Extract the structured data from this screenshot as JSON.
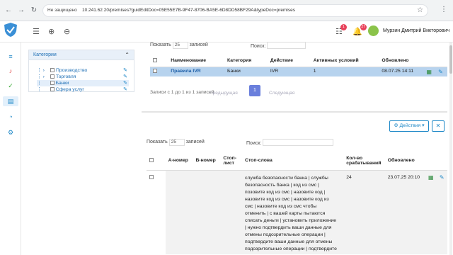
{
  "browser": {
    "warning": "Не защищено",
    "url": "10.241.62.20/premises?guidEditDoc=05E55E7B-9F47-8706-BA5E-6D8DD58BF29A&typeDoc=premises"
  },
  "header": {
    "user_name": "Мурзин Дмитрий Викторович",
    "badge_tasks": "1",
    "badge_notifications": "27"
  },
  "categories": {
    "title": "Категории",
    "items": [
      {
        "label": "Производство"
      },
      {
        "label": "Торговля"
      },
      {
        "label": "Банки"
      },
      {
        "label": "Сфера услуг"
      }
    ]
  },
  "table1": {
    "show_label": "Показать",
    "page_size": "25",
    "records_label": "записей",
    "search_label": "Поиск:",
    "headers": [
      "Наименование",
      "Категория",
      "Действие",
      "Активных условий",
      "Обновлено"
    ],
    "row": {
      "name": "Правила IVR",
      "category": "Банки",
      "action": "IVR",
      "active": "1",
      "updated": "08.07.25 14:11"
    },
    "info": "Записи с 1 до 1 из 1 записей",
    "prev": "Предыдущая",
    "page": "1",
    "next": "Следующая"
  },
  "table2": {
    "show_label": "Показать",
    "page_size": "25",
    "records_label": "записей",
    "search_label": "Поиск:",
    "actions_label": "Действия",
    "headers": [
      "А-номер",
      "В-номер",
      "Стоп-лист",
      "Стоп-слова",
      "Кол-во срабатываний",
      "Обновлено"
    ],
    "row": {
      "a": "",
      "b": "",
      "stop": "",
      "words": "служба безопасности банка | службы безопасность банка | код из смс | позовите код из смс | назовите код | назовите код из смс | назовите код из смс | назовите код из смс чтобы отменить | с вашей карты пытаются списать деньги | установить приложение | нужно подтвердить ваши данные для отмены подозрительные операции | подтвердите ваши данные для отмены подозрительные операции | подтвердите",
      "count": "24",
      "updated": "23.07.25 20:10"
    }
  }
}
